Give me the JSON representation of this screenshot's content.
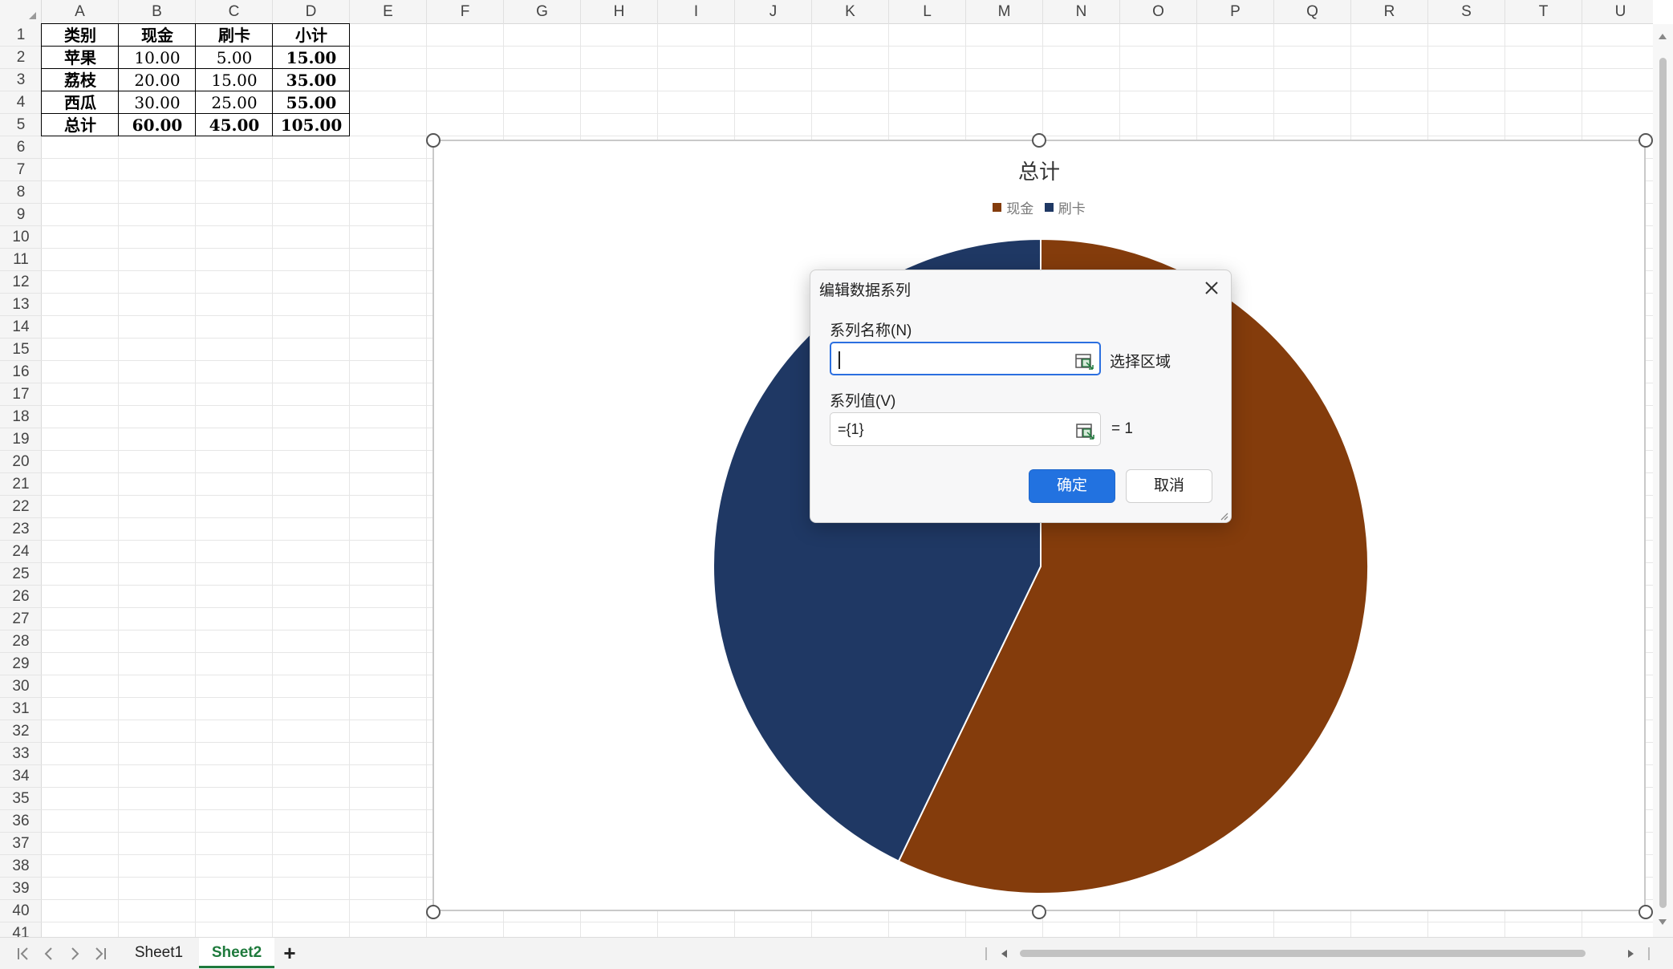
{
  "columns": [
    "A",
    "B",
    "C",
    "D",
    "E",
    "F",
    "G",
    "H",
    "I",
    "J",
    "K",
    "L",
    "M",
    "N",
    "O",
    "P",
    "Q",
    "R",
    "S",
    "T",
    "U"
  ],
  "rows": [
    "1",
    "2",
    "3",
    "4",
    "5",
    "6",
    "7",
    "8",
    "9",
    "10",
    "11",
    "12",
    "13",
    "14",
    "15",
    "16",
    "17",
    "18",
    "19",
    "20",
    "21",
    "22",
    "23",
    "24",
    "25",
    "26",
    "27",
    "28",
    "29",
    "30",
    "31",
    "32",
    "33",
    "34",
    "35",
    "36",
    "37",
    "38",
    "39",
    "40",
    "41"
  ],
  "table": {
    "header": [
      "类别",
      "现金",
      "刷卡",
      "小计"
    ],
    "rows": [
      [
        "苹果",
        "10.00",
        "5.00",
        "15.00"
      ],
      [
        "荔枝",
        "20.00",
        "15.00",
        "35.00"
      ],
      [
        "西瓜",
        "30.00",
        "25.00",
        "55.00"
      ],
      [
        "总计",
        "60.00",
        "45.00",
        "105.00"
      ]
    ]
  },
  "chart_data": {
    "type": "pie",
    "title": "总计",
    "categories": [
      "现金",
      "刷卡"
    ],
    "values": [
      60.0,
      45.0
    ],
    "colors": [
      "#843c0c",
      "#1f3864"
    ],
    "legend_position": "top"
  },
  "dialog": {
    "title": "编辑数据系列",
    "series_name_label": "系列名称(N)",
    "series_name_value": "",
    "series_name_side": "选择区域",
    "series_values_label": "系列值(V)",
    "series_values_value": "={1}",
    "series_values_side": "= 1",
    "ok_label": "确定",
    "cancel_label": "取消",
    "icons": [
      "close-icon",
      "range-select-icon",
      "resize-grip-icon"
    ]
  },
  "sheets": {
    "tabs": [
      "Sheet1",
      "Sheet2"
    ],
    "active": "Sheet2",
    "add_label": "+"
  },
  "nav_icons": [
    "first-sheet-icon",
    "prev-sheet-icon",
    "next-sheet-icon",
    "last-sheet-icon"
  ]
}
